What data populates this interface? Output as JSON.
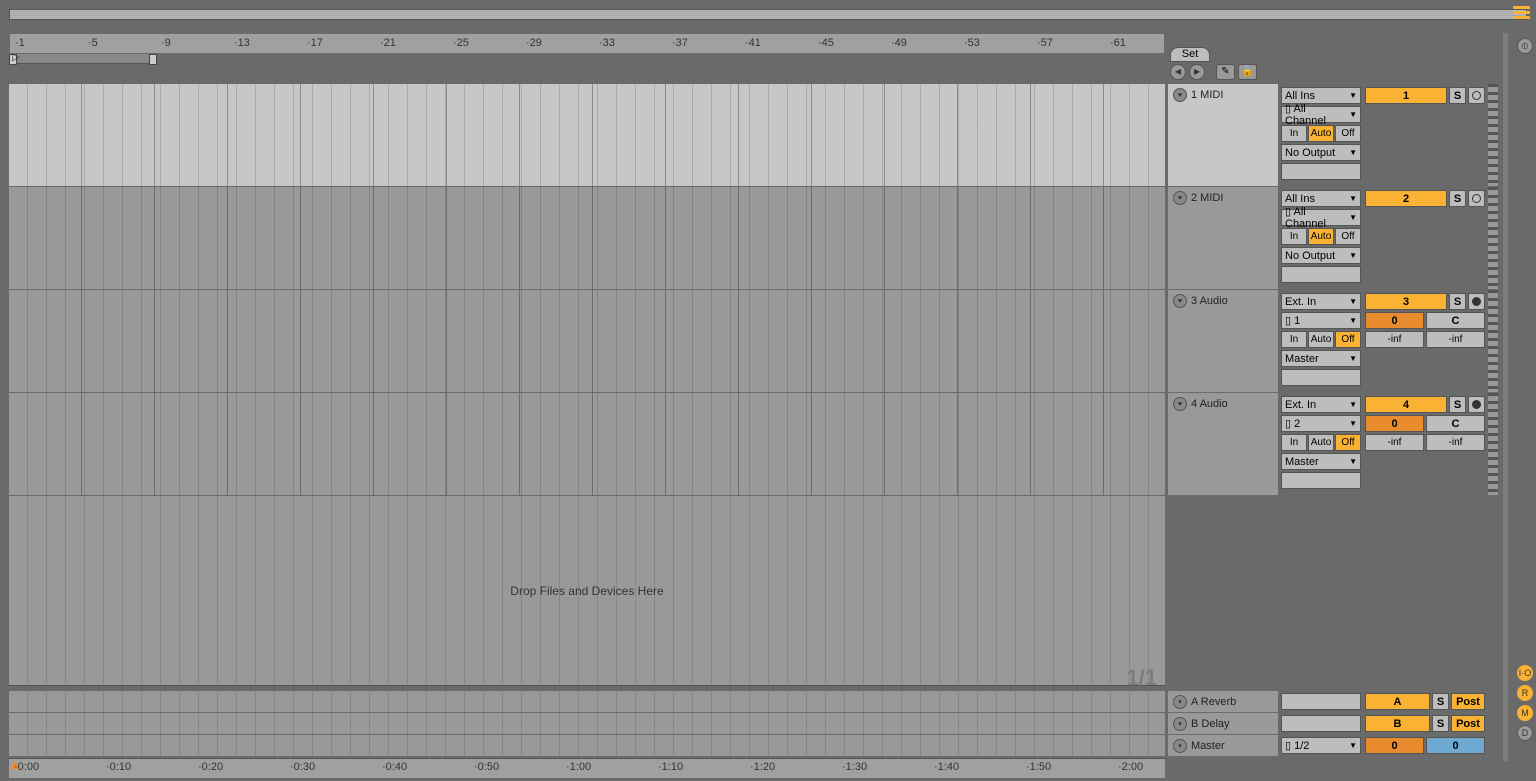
{
  "ruler": {
    "marks": [
      "1",
      "5",
      "9",
      "13",
      "17",
      "21",
      "25",
      "29",
      "33",
      "37",
      "41",
      "45",
      "49",
      "53",
      "57",
      "61"
    ]
  },
  "set_label": "Set",
  "drop_text": "Drop Files and Devices Here",
  "locator": "1/1",
  "tracks": [
    {
      "name": "1 MIDI",
      "sel": true,
      "io": {
        "in": "All Ins",
        "ch": "All Channel",
        "mon": {
          "in": "In",
          "auto": "Auto",
          "off": "Off",
          "active": "auto"
        },
        "out": "No Output"
      },
      "mix": {
        "num": "1",
        "solo": "S",
        "arm": "○"
      }
    },
    {
      "name": "2 MIDI",
      "sel": false,
      "io": {
        "in": "All Ins",
        "ch": "All Channel",
        "mon": {
          "in": "In",
          "auto": "Auto",
          "off": "Off",
          "active": "auto"
        },
        "out": "No Output"
      },
      "mix": {
        "num": "2",
        "solo": "S",
        "arm": "○"
      }
    },
    {
      "name": "3 Audio",
      "sel": false,
      "io": {
        "in": "Ext. In",
        "ch": "1",
        "mon": {
          "in": "In",
          "auto": "Auto",
          "off": "Off",
          "active": "off"
        },
        "out": "Master"
      },
      "mix": {
        "num": "3",
        "solo": "S",
        "arm": "●",
        "send": "0",
        "pan": "C",
        "sendA": "-inf",
        "sendB": "-inf"
      }
    },
    {
      "name": "4 Audio",
      "sel": false,
      "io": {
        "in": "Ext. In",
        "ch": "2",
        "mon": {
          "in": "In",
          "auto": "Auto",
          "off": "Off",
          "active": "off"
        },
        "out": "Master"
      },
      "mix": {
        "num": "4",
        "solo": "S",
        "arm": "●",
        "send": "0",
        "pan": "C",
        "sendA": "-inf",
        "sendB": "-inf"
      }
    }
  ],
  "returns": [
    {
      "name": "A Reverb",
      "num": "A",
      "solo": "S",
      "post": "Post"
    },
    {
      "name": "B Delay",
      "num": "B",
      "solo": "S",
      "post": "Post"
    }
  ],
  "master": {
    "name": "Master",
    "out": "1/2",
    "send": "0",
    "cue": "0"
  },
  "time_marks": [
    "0:00",
    "0:10",
    "0:20",
    "0:30",
    "0:40",
    "0:50",
    "1:00",
    "1:10",
    "1:20",
    "1:30",
    "1:40",
    "1:50",
    "2:00"
  ],
  "side_tool_labels": {
    "io": "I·O",
    "r": "R",
    "m": "M",
    "d": "D"
  }
}
